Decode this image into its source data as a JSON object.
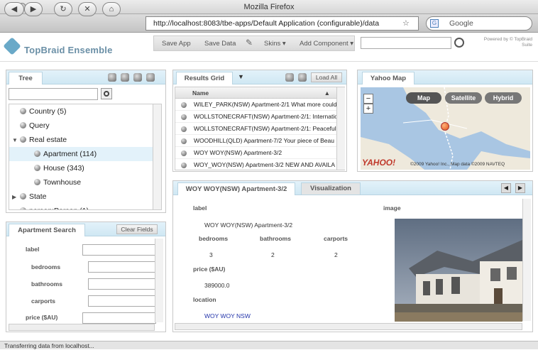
{
  "window": {
    "title": "Mozilla Firefox"
  },
  "browser": {
    "url": "http://localhost:8083/tbe-apps/Default Application (configurable)/data",
    "search_engine": "Google",
    "back_label": "◀",
    "forward_label": "▶",
    "reload_label": "↻",
    "stop_label": "✕",
    "home_label": "⌂"
  },
  "app": {
    "brand": "TopBraid Ensemble",
    "powered_by": "Powered by © TopBraid Suite",
    "toolbar": {
      "save_app": "Save App",
      "save_data": "Save Data",
      "skins": "Skins ▾",
      "add_component": "Add Component ▾"
    }
  },
  "tree": {
    "tab": "Tree",
    "items": [
      {
        "label": "Country  (5)",
        "expander": "",
        "level": 0
      },
      {
        "label": "Query",
        "expander": "",
        "level": 0
      },
      {
        "label": "Real estate",
        "expander": "▼",
        "level": 0
      },
      {
        "label": "Apartment  (114)",
        "expander": "",
        "level": 1
      },
      {
        "label": "House  (343)",
        "expander": "",
        "level": 1
      },
      {
        "label": "Townhouse",
        "expander": "",
        "level": 1
      },
      {
        "label": "State",
        "expander": "▶",
        "level": 0
      },
      {
        "label": "person:Person  (1)",
        "expander": "▶",
        "level": 0
      }
    ]
  },
  "search_form": {
    "tab": "Apartment Search",
    "clear_button": "Clear Fields",
    "fields": {
      "label": "label",
      "bedrooms": "bedrooms",
      "bathrooms": "bathrooms",
      "carports": "carports",
      "price": "price ($AU)"
    }
  },
  "results": {
    "tab": "Results Grid",
    "load_all": "Load All",
    "column": "Name",
    "rows": [
      "WILEY_PARK(NSW) Apartment-2/1  What more could",
      "WOLLSTONECRAFT(NSW) Apartment-2/1: Internatio",
      "WOLLSTONECRAFT(NSW) Apartment-2/1: Peaceful li",
      "WOODHILL(QLD) Apartment-7/2  Your piece of Beau",
      "WOY WOY(NSW) Apartment-3/2",
      "WOY_WOY(NSW) Apartment-3/2  NEW AND AVAILA"
    ]
  },
  "map": {
    "tab": "Yahoo Map",
    "buttons": {
      "map": "Map",
      "satellite": "Satellite",
      "hybrid": "Hybrid"
    },
    "zoom_out": "−",
    "zoom_in": "+",
    "logo": "YAHOO!",
    "copyright": "©2009 Yahoo! Inc., Map data ©2009 NAVTEQ"
  },
  "detail": {
    "tab": "WOY WOY(NSW) Apartment-3/2",
    "tab2": "Visualization",
    "label_heading": "label",
    "label_value": "WOY WOY(NSW) Apartment-3/2",
    "bedrooms_heading": "bedrooms",
    "bathrooms_heading": "bathrooms",
    "carports_heading": "carports",
    "bedrooms": "3",
    "bathrooms": "2",
    "carports": "2",
    "price_heading": "price ($AU)",
    "price": "389000.0",
    "location_heading": "location",
    "location": "WOY WOY NSW",
    "image_heading": "image"
  },
  "status": "Transferring data from localhost..."
}
